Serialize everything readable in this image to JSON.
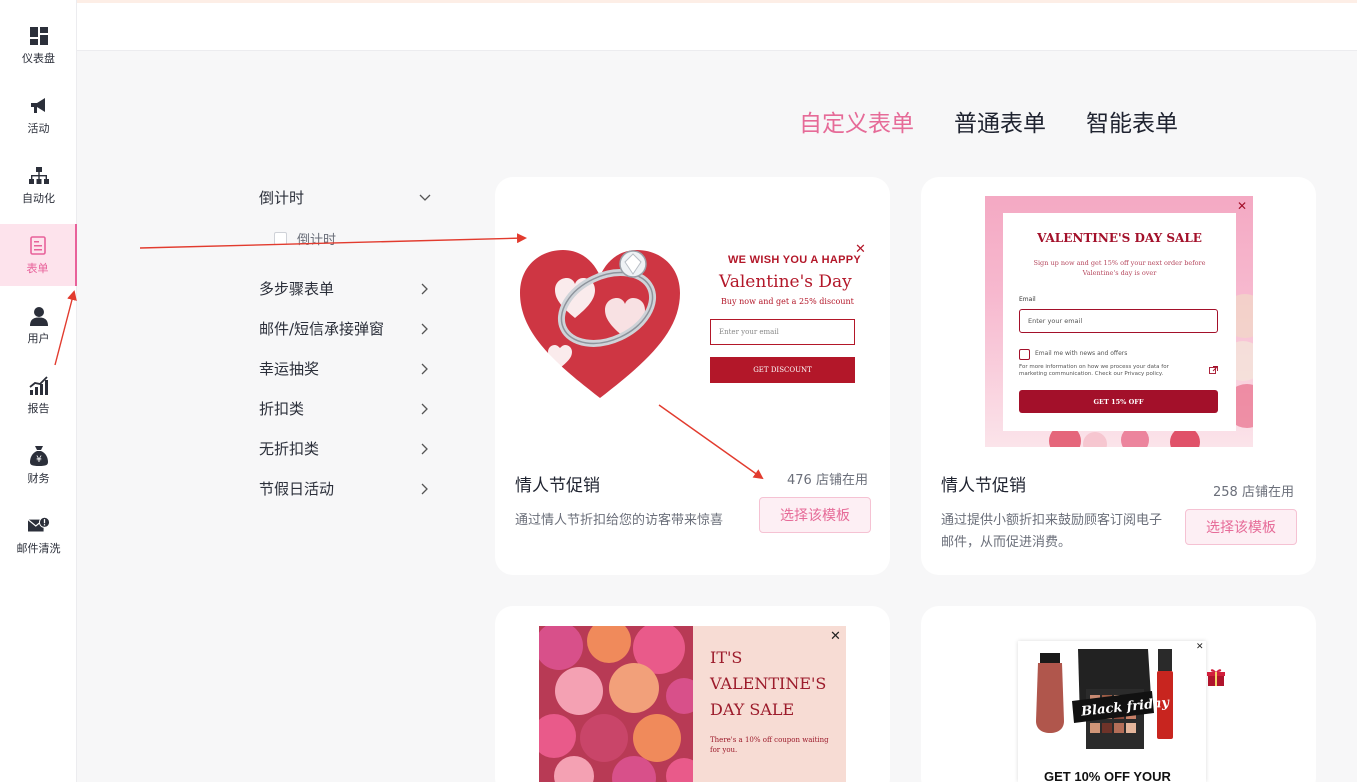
{
  "sidebar": {
    "items": [
      {
        "label": "仪表盘",
        "icon": "dashboard-icon"
      },
      {
        "label": "活动",
        "icon": "megaphone-icon"
      },
      {
        "label": "自动化",
        "icon": "sitemap-icon"
      },
      {
        "label": "表单",
        "icon": "form-icon",
        "active": true
      },
      {
        "label": "用户",
        "icon": "user-icon"
      },
      {
        "label": "报告",
        "icon": "chart-icon"
      },
      {
        "label": "财务",
        "icon": "money-bag-icon"
      },
      {
        "label": "邮件清洗",
        "icon": "mail-alert-icon"
      }
    ]
  },
  "tabs": [
    "自定义表单",
    "普通表单",
    "智能表单"
  ],
  "categories": {
    "items": [
      {
        "label": "倒计时",
        "expanded": true
      },
      {
        "label": "多步骤表单"
      },
      {
        "label": "邮件/短信承接弹窗"
      },
      {
        "label": "幸运抽奖"
      },
      {
        "label": "折扣类"
      },
      {
        "label": "无折扣类"
      },
      {
        "label": "节假日活动"
      }
    ],
    "sub_item": "倒计时"
  },
  "cards": [
    {
      "title": "情人节促销",
      "count": "476 店铺在用",
      "desc": "通过情人节折扣给您的访客带来惊喜",
      "button": "选择该模板",
      "preview": {
        "wish": "WE WISH YOU A HAPPY",
        "vday": "Valentine's Day",
        "buy": "Buy now and get a 25% discount",
        "email_placeholder": "Enter your email",
        "cta": "GET DISCOUNT"
      }
    },
    {
      "title": "情人节促销",
      "count": "258 店铺在用",
      "desc_line1": "通过提供小额折扣来鼓励顾客订阅电子",
      "desc_line2": "邮件，从而促进消费。",
      "button": "选择该模板",
      "preview": {
        "title": "VALENTINE'S DAY SALE",
        "sub": "Sign up now and get 15% off your next order before Valentine's day is over",
        "email_label": "Email",
        "email_placeholder": "Enter your email",
        "check_label": "Email me with news and offers",
        "info": "For more information on how we process your data for marketing communication. Check our Privacy policy.",
        "cta": "GET 15% OFF"
      }
    },
    {
      "preview": {
        "title_l1": "IT'S",
        "title_l2": "VALENTINE'S",
        "title_l3": "DAY SALE",
        "sub": "There's a 10% off coupon waiting for you."
      }
    },
    {
      "preview": {
        "badge": "Black friday",
        "heading": "GET 10% OFF YOUR"
      }
    }
  ],
  "colors": {
    "accent": "#e66b98",
    "valentine_red": "#b31729",
    "arrow": "#e23b2e"
  }
}
